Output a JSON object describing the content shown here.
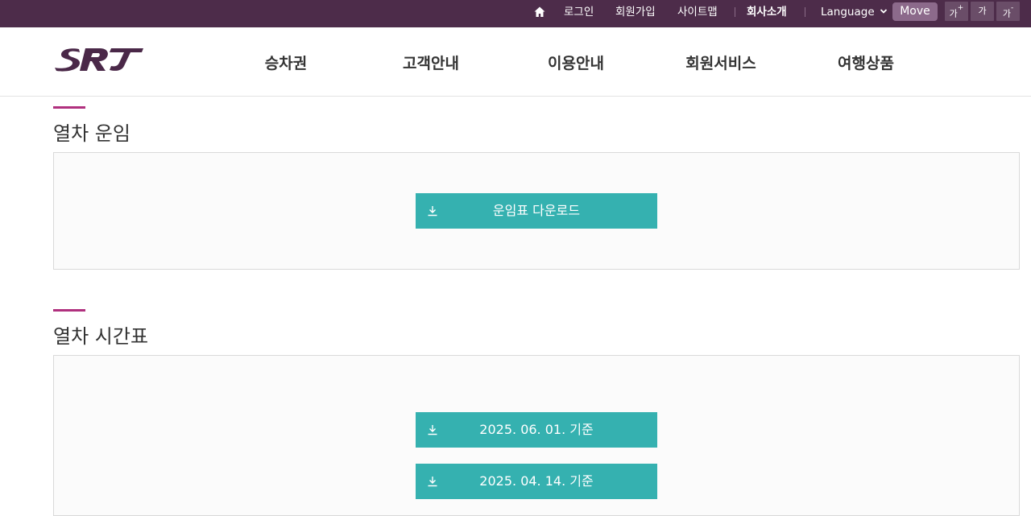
{
  "topbar": {
    "login": "로그인",
    "signup": "회원가입",
    "sitemap": "사이트맵",
    "company": "회사소개",
    "language": "Language",
    "move": "Move",
    "font_larger": "가",
    "font_larger_sign": "+",
    "font_default": "가",
    "font_smaller": "가",
    "font_smaller_sign": "-"
  },
  "header": {
    "nav": [
      "승차권",
      "고객안내",
      "이용안내",
      "회원서비스",
      "여행상품"
    ]
  },
  "sections": {
    "operation": {
      "title": "열차 운임",
      "download_label": "운임표 다운로드"
    },
    "timetable": {
      "title": "열차 시간표",
      "downloads": [
        "2025. 06. 01. 기준",
        "2025. 04. 14. 기준"
      ]
    }
  },
  "colors": {
    "topbar_bg": "#4d2c4a",
    "accent": "#b0307e",
    "button_teal": "#35b1b0",
    "logo": "#4a2848"
  },
  "icons": {
    "home": "home-icon",
    "language_caret": "chevron-down-icon",
    "download": "download-icon",
    "logo": "srt-logo"
  }
}
